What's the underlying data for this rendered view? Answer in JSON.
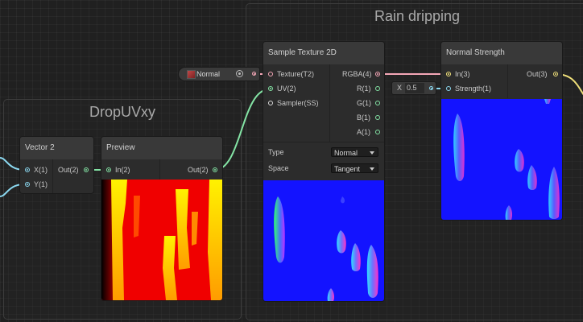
{
  "groups": {
    "rain": {
      "title": "Rain dripping"
    },
    "drop": {
      "title": "DropUVxy"
    }
  },
  "texture_prop": {
    "label": "Normal"
  },
  "strength_input": {
    "axis": "X",
    "value": "0.5"
  },
  "nodes": {
    "vector2": {
      "title": "Vector 2",
      "in_x": "X(1)",
      "in_y": "Y(1)",
      "out": "Out(2)"
    },
    "preview": {
      "title": "Preview",
      "in": "In(2)",
      "out": "Out(2)"
    },
    "sample": {
      "title": "Sample Texture 2D",
      "in_texture": "Texture(T2)",
      "in_uv": "UV(2)",
      "in_sampler": "Sampler(SS)",
      "out_rgba": "RGBA(4)",
      "out_r": "R(1)",
      "out_g": "G(1)",
      "out_b": "B(1)",
      "out_a": "A(1)",
      "type_label": "Type",
      "type_value": "Normal",
      "space_label": "Space",
      "space_value": "Tangent"
    },
    "strength": {
      "title": "Normal Strength",
      "in": "In(3)",
      "in_strength": "Strength(1)",
      "out": "Out(3)"
    }
  },
  "colors": {
    "vec2": "#84e4a5",
    "vec1": "#8bd8f0",
    "vec3": "#f0e07a",
    "texture": "#f4a6b6",
    "normal_map": "#1313ff"
  }
}
